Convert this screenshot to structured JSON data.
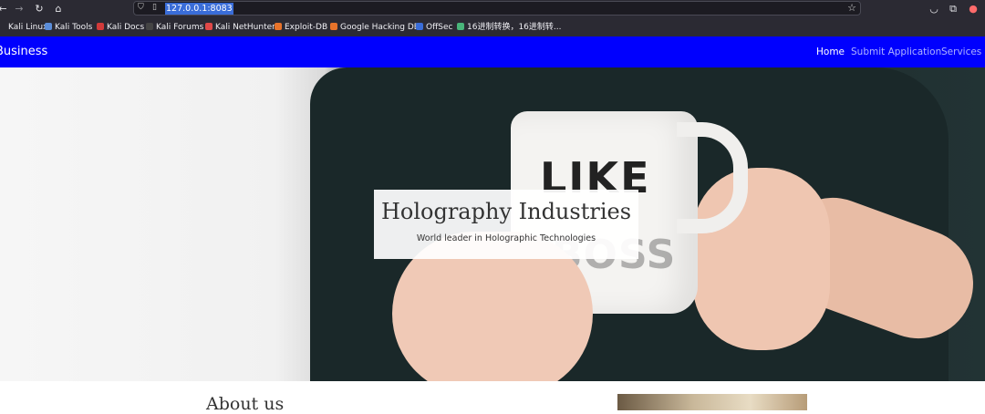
{
  "browser": {
    "url": "127.0.0.1:8083",
    "bookmarks": [
      {
        "label": "Kali Linux",
        "icon": "kali-icon"
      },
      {
        "label": "Kali Tools",
        "icon": "kali-tools-icon"
      },
      {
        "label": "Kali Docs",
        "icon": "kali-docs-icon"
      },
      {
        "label": "Kali Forums",
        "icon": "kali-forums-icon"
      },
      {
        "label": "Kali NetHunter",
        "icon": "nethunter-icon"
      },
      {
        "label": "Exploit-DB",
        "icon": "exploit-db-icon"
      },
      {
        "label": "Google Hacking DB",
        "icon": "ghdb-icon"
      },
      {
        "label": "OffSec",
        "icon": "offsec-icon"
      },
      {
        "label": "16进制转换，16进制转...",
        "icon": "hex-icon"
      }
    ]
  },
  "navbar": {
    "brand": "Business",
    "links": [
      {
        "label": "Home",
        "active": true
      },
      {
        "label": "Submit Application",
        "active": false
      },
      {
        "label": "Services",
        "active": false
      }
    ],
    "color": "#0000fe"
  },
  "hero": {
    "title": "Holography Industries",
    "subtitle": "World leader in Holographic Technologies",
    "mug_text_top": "LIKE",
    "mug_text_bottom": "BOSS"
  },
  "about": {
    "heading": "About us"
  }
}
